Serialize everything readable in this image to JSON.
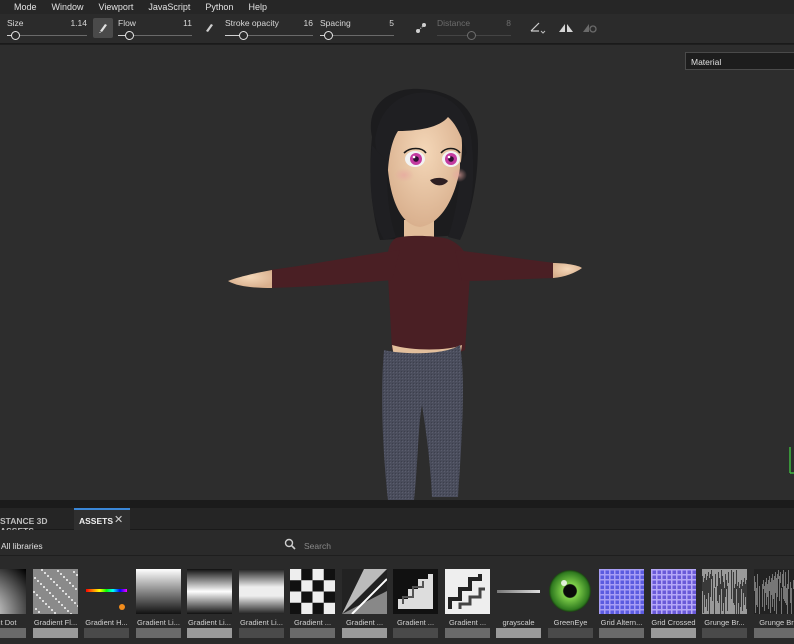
{
  "menu": [
    "Mode",
    "Window",
    "Viewport",
    "JavaScript",
    "Python",
    "Help"
  ],
  "toolbar": {
    "size": {
      "label": "Size",
      "value": "1.14",
      "level": 0.05
    },
    "flow": {
      "label": "Flow",
      "value": "11",
      "level": 0.1
    },
    "stroke_opacity": {
      "label": "Stroke opacity",
      "value": "16",
      "level": 0.16
    },
    "spacing": {
      "label": "Spacing",
      "value": "5",
      "level": 0.05
    },
    "distance": {
      "label": "Distance",
      "value": "8",
      "level": 0.4
    }
  },
  "viewport": {
    "material_dropdown": "Material"
  },
  "panel": {
    "tabs": [
      {
        "label": "STANCE 3D ASSETS",
        "active": false
      },
      {
        "label": "ASSETS",
        "active": true
      }
    ],
    "libraries_label": "All libraries",
    "search_placeholder": "Search",
    "assets": [
      {
        "name": "ient Dot",
        "icon": "gradient-dot"
      },
      {
        "name": "Gradient Fl...",
        "icon": "noise"
      },
      {
        "name": "Gradient H...",
        "icon": "gradient-hue"
      },
      {
        "name": "Gradient Li...",
        "icon": "gradient-linear-1"
      },
      {
        "name": "Gradient Li...",
        "icon": "gradient-linear-2"
      },
      {
        "name": "Gradient Li...",
        "icon": "gradient-linear-3"
      },
      {
        "name": "Gradient ...",
        "icon": "gradient-checker"
      },
      {
        "name": "Gradient ...",
        "icon": "gradient-diagonal"
      },
      {
        "name": "Gradient ...",
        "icon": "gradient-stairs"
      },
      {
        "name": "Gradient ...",
        "icon": "gradient-stairs-2"
      },
      {
        "name": "grayscale",
        "icon": "grayscale-line"
      },
      {
        "name": "GreenEye",
        "icon": "green-eye"
      },
      {
        "name": "Grid Altern...",
        "icon": "grid-alternating"
      },
      {
        "name": "Grid Crossed",
        "icon": "grid-crossed"
      },
      {
        "name": "Grunge Br...",
        "icon": "grunge-brush"
      },
      {
        "name": "Grunge Br",
        "icon": "grunge-brush-2"
      }
    ]
  },
  "colors": {
    "accent": "#3a86d6",
    "viewport_bg": "#2d2d2d",
    "panel_bg": "#2a2a2a"
  }
}
